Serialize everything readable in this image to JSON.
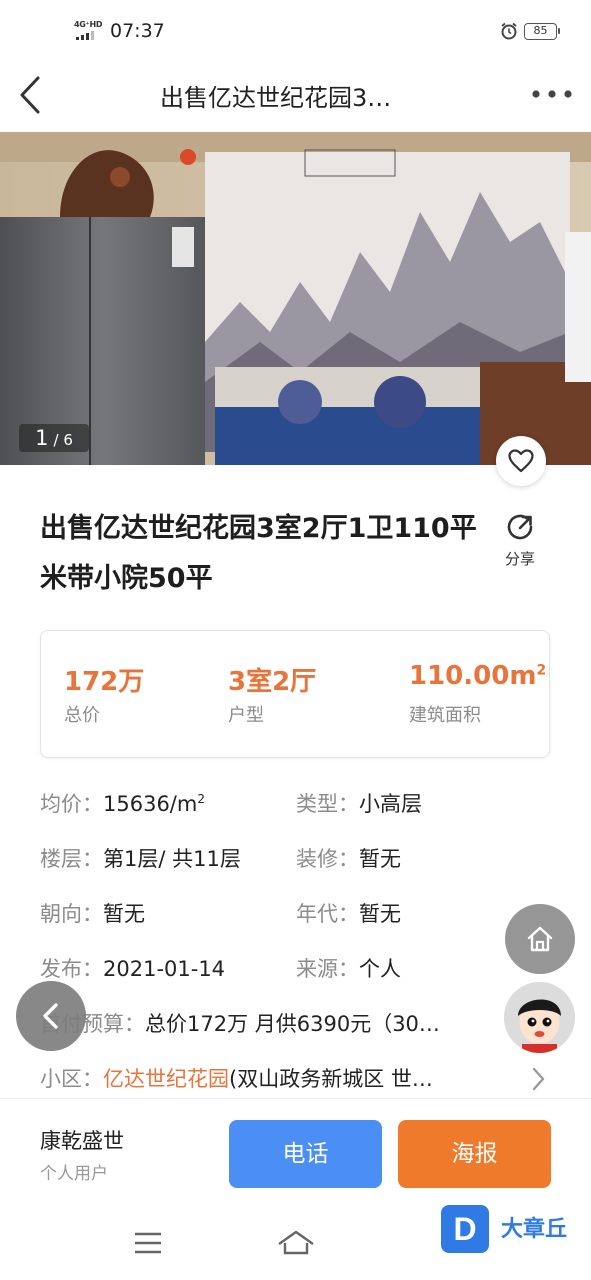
{
  "status_bar": {
    "network": "4G⁺HD",
    "time": "07:37",
    "battery": "85"
  },
  "nav": {
    "title": "出售亿达世纪花园3…",
    "back_icon": "chevron-left-icon",
    "more_icon": "more-dots-icon"
  },
  "gallery": {
    "current": "1",
    "separator_total": "/ 6"
  },
  "listing": {
    "title": "出售亿达世纪花园3室2厅1卫110平米带小院50平",
    "share_label": "分享"
  },
  "key_facts": {
    "price_value": "172万",
    "price_label": "总价",
    "layout_value": "3室2厅",
    "layout_label": "户型",
    "area_value": "110.00m",
    "area_unit_sup": "2",
    "area_label": "建筑面积"
  },
  "attributes": {
    "unit_price_key": "均价：",
    "unit_price_value": "15636/m",
    "unit_price_sup": "2",
    "type_key": "类型：",
    "type_value": "小高层",
    "floor_key": "楼层：",
    "floor_value": "第1层/ 共11层",
    "decoration_key": "装修：",
    "decoration_value": "暂无",
    "orientation_key": "朝向：",
    "orientation_value": "暂无",
    "year_key": "年代：",
    "year_value": "暂无",
    "published_key": "发布：",
    "published_value": "2021-01-14",
    "source_key": "来源：",
    "source_value": "个人",
    "down_payment_key": "首付预算：",
    "down_payment_value": "总价172万 月供6390元（30…",
    "community_key": "小区：",
    "community_name": "亿达世纪花园",
    "community_detail": "(双山政务新城区 世…"
  },
  "seller": {
    "name": "康乾盛世",
    "type": "个人用户",
    "call_label": "电话",
    "poster_label": "海报"
  },
  "watermark": {
    "logo_letter": "D",
    "brand": "大章丘"
  },
  "colors": {
    "accent_orange": "#e8743b",
    "call_blue": "#4b8ff4",
    "poster_orange": "#f07a2c"
  }
}
